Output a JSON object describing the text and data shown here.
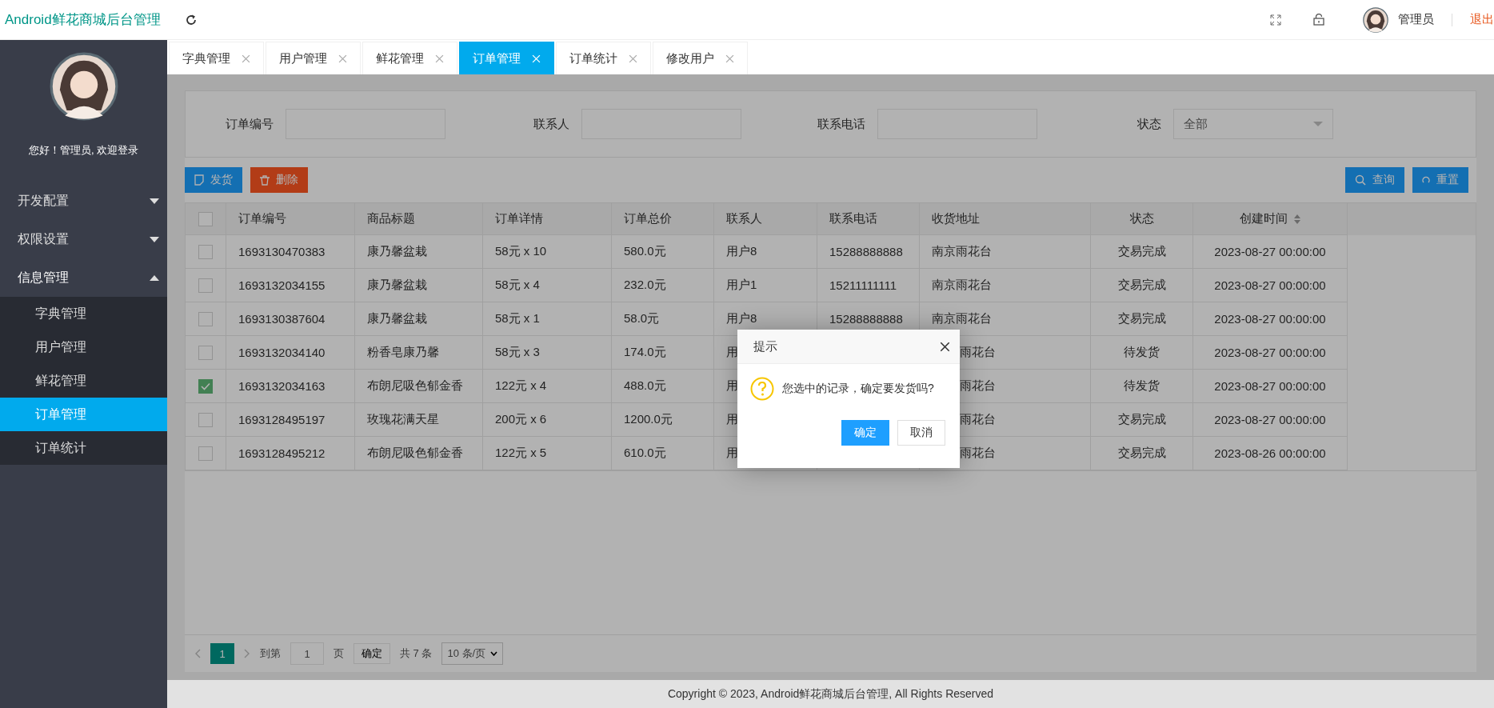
{
  "header": {
    "title": "Android鲜花商城后台管理",
    "user": "管理员",
    "logout": "退出"
  },
  "sidebar": {
    "greeting": "您好！管理员, 欢迎登录",
    "menu": [
      {
        "label": "开发配置",
        "expanded": false
      },
      {
        "label": "权限设置",
        "expanded": false
      },
      {
        "label": "信息管理",
        "expanded": true,
        "children": [
          {
            "label": "字典管理",
            "selected": false
          },
          {
            "label": "用户管理",
            "selected": false
          },
          {
            "label": "鲜花管理",
            "selected": false
          },
          {
            "label": "订单管理",
            "selected": true
          },
          {
            "label": "订单统计",
            "selected": false
          }
        ]
      }
    ]
  },
  "tabs": [
    {
      "label": "字典管理",
      "selected": false
    },
    {
      "label": "用户管理",
      "selected": false
    },
    {
      "label": "鲜花管理",
      "selected": false
    },
    {
      "label": "订单管理",
      "selected": true
    },
    {
      "label": "订单统计",
      "selected": false
    },
    {
      "label": "修改用户",
      "selected": false
    }
  ],
  "search": {
    "fields": [
      {
        "label": "订单编号",
        "kind": "text"
      },
      {
        "label": "联系人",
        "kind": "text"
      },
      {
        "label": "联系电话",
        "kind": "text"
      },
      {
        "label": "状态",
        "kind": "select",
        "value": "全部"
      }
    ]
  },
  "actions": [
    {
      "label": "发货",
      "kind": "ship"
    },
    {
      "label": "删除",
      "kind": "delete"
    }
  ],
  "tools": [
    {
      "label": "查询",
      "kind": "search"
    },
    {
      "label": "重置",
      "kind": "reset"
    }
  ],
  "table": {
    "all_checked": false,
    "columns": [
      {
        "label": "订单编号",
        "sortable": false
      },
      {
        "label": "商品标题",
        "sortable": false
      },
      {
        "label": "订单详情",
        "sortable": false
      },
      {
        "label": "订单总价",
        "sortable": false
      },
      {
        "label": "联系人",
        "sortable": false
      },
      {
        "label": "联系电话",
        "sortable": false
      },
      {
        "label": "收货地址",
        "sortable": false
      },
      {
        "label": "状态",
        "sortable": false
      },
      {
        "label": "创建时间",
        "sortable": true
      }
    ],
    "rows": [
      {
        "checked": false,
        "order_no": "1693130470383",
        "title": "康乃馨盆栽",
        "detail": "58元 x 10",
        "total": "580.0元",
        "contact": "用户8",
        "phone": "15288888888",
        "address": "南京雨花台",
        "status": "交易完成",
        "created": "2023-08-27 00:00:00"
      },
      {
        "checked": false,
        "order_no": "1693132034155",
        "title": "康乃馨盆栽",
        "detail": "58元 x 4",
        "total": "232.0元",
        "contact": "用户1",
        "phone": "15211111111",
        "address": "南京雨花台",
        "status": "交易完成",
        "created": "2023-08-27 00:00:00"
      },
      {
        "checked": false,
        "order_no": "1693130387604",
        "title": "康乃馨盆栽",
        "detail": "58元 x 1",
        "total": "58.0元",
        "contact": "用户8",
        "phone": "15288888888",
        "address": "南京雨花台",
        "status": "交易完成",
        "created": "2023-08-27 00:00:00"
      },
      {
        "checked": false,
        "order_no": "1693132034140",
        "title": "粉香皂康乃馨",
        "detail": "58元 x 3",
        "total": "174.0元",
        "contact": "用",
        "address_tail": "雨花台",
        "status": "待发货",
        "created": "2023-08-27 00:00:00"
      },
      {
        "checked": true,
        "order_no": "1693132034163",
        "title": "布朗尼吸色郁金香",
        "detail": "122元 x 4",
        "total": "488.0元",
        "contact": "用",
        "address_tail": "雨花台",
        "status": "待发货",
        "created": "2023-08-27 00:00:00"
      },
      {
        "checked": false,
        "order_no": "1693128495197",
        "title": "玫瑰花满天星",
        "detail": "200元 x 6",
        "total": "1200.0元",
        "contact": "用",
        "address_tail": "雨花台",
        "status": "交易完成",
        "created": "2023-08-27 00:00:00"
      },
      {
        "checked": false,
        "order_no": "1693128495212",
        "title": "布朗尼吸色郁金香",
        "detail": "122元 x 5",
        "total": "610.0元",
        "contact": "用",
        "address_tail": "雨花台",
        "status": "交易完成",
        "created": "2023-08-26 00:00:00"
      }
    ]
  },
  "pagination": {
    "current": "1",
    "goto_label": "到第",
    "page_value": "1",
    "page_unit": "页",
    "confirm": "确定",
    "total": "共 7 条",
    "page_size": "10 条/页"
  },
  "dialog": {
    "title": "提示",
    "message": "您选中的记录，确定要发货吗?",
    "ok": "确定",
    "cancel": "取消"
  },
  "footer": "Copyright © 2023, Android鲜花商城后台管理, All Rights Reserved"
}
